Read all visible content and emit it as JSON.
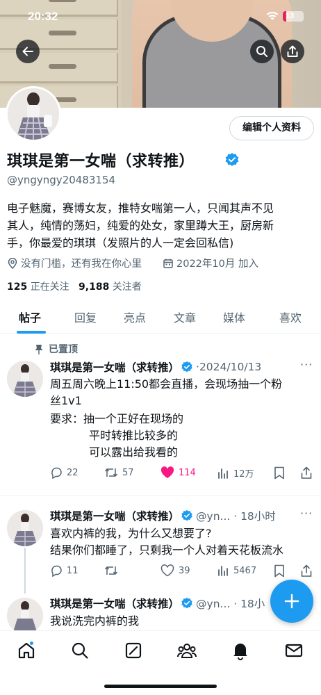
{
  "status_bar": {
    "time": "20:32",
    "battery": "13"
  },
  "profile": {
    "name": "琪琪是第一女喘（求转推）",
    "handle": "@yngyngy20483154",
    "edit_button": "编辑个人资料",
    "bio_lines": [
      "电子魅魔，赛博女友，推特女喘第一人，只闻其声不见",
      "其人，纯情的荡妇，纯爱的处女，家里蹲大王，厨房新",
      "手，你最爱的琪琪（发照片的人一定会回私信)"
    ],
    "location": "没有门槛，还有我在你心里",
    "joined": "2022年10月 加入",
    "following_count": "125",
    "following_label": "正在关注",
    "followers_count": "9,188",
    "followers_label": "关注者"
  },
  "tabs": [
    "帖子",
    "回复",
    "亮点",
    "文章",
    "媒体",
    "喜欢"
  ],
  "active_tab": "帖子",
  "pinned_label": "已置顶",
  "posts": [
    {
      "name": "琪琪是第一女喘（求转推）",
      "meta": "·2024/10/13",
      "lines": [
        "周五周六晚上11:50都会直播，会现场抽一个粉",
        "丝1v1",
        "要求：抽一个正好在现场的",
        "平时转推比较多的",
        "可以露出给我看的"
      ],
      "replies": "22",
      "retweets": "57",
      "likes": "114",
      "views": "12万"
    },
    {
      "name": "琪琪是第一女喘（求转推）",
      "meta": "@yn... · 18小时",
      "lines": [
        "喜欢内裤的我，为什么又想要了?",
        "结果你们都睡了，只剩我一个人对着天花板流水"
      ],
      "replies": "11",
      "retweets": "",
      "likes": "39",
      "views": "5467"
    },
    {
      "name": "琪琪是第一女喘（求转推）",
      "meta": "@yn... · 18小",
      "lines": [
        "我说洗完内裤的我"
      ]
    }
  ],
  "colors": {
    "accent": "#1d9bf0",
    "like": "#f91880",
    "text": "#0f1419",
    "muted": "#536471"
  }
}
